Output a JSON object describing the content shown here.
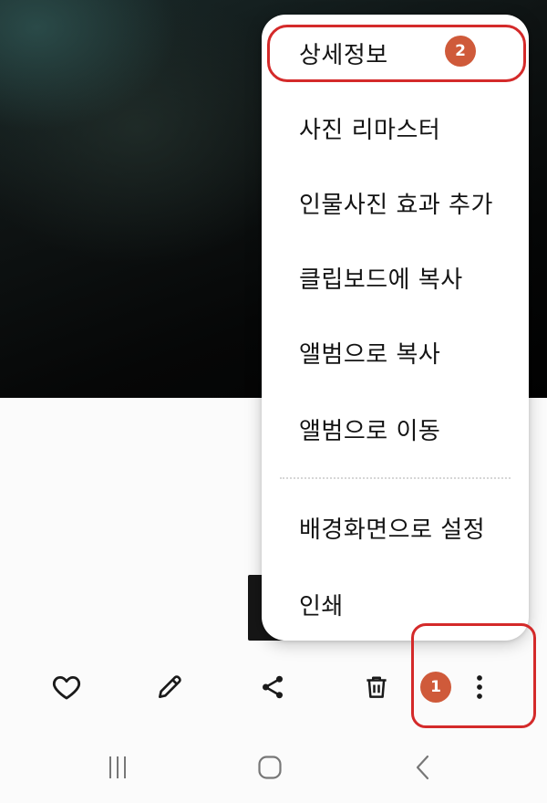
{
  "viewer": {
    "photo_alt": "dark blurred photo"
  },
  "context_menu": {
    "items": [
      {
        "label": "상세정보"
      },
      {
        "label": "사진 리마스터"
      },
      {
        "label": "인물사진 효과 추가"
      },
      {
        "label": "클립보드에 복사"
      },
      {
        "label": "앨범으로 복사"
      },
      {
        "label": "앨범으로 이동"
      },
      {
        "label": "배경화면으로 설정"
      },
      {
        "label": "인쇄"
      }
    ]
  },
  "annotations": {
    "badge_1": "1",
    "badge_2": "2",
    "highlight_color": "#d42a2a",
    "badge_color": "#cf5a3a"
  },
  "bottom_bar": {
    "icons": [
      "heart-icon",
      "pencil-icon",
      "share-icon",
      "trash-icon",
      "more-vertical-icon"
    ]
  },
  "nav_bar": {
    "icons": [
      "recents-icon",
      "home-icon",
      "back-icon"
    ]
  }
}
